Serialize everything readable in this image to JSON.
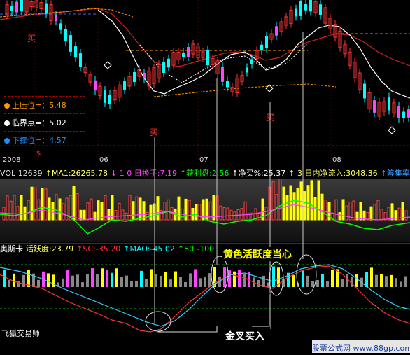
{
  "price_panel": {
    "buy_marks": [
      "买",
      "买",
      "买"
    ],
    "levels": [
      {
        "label": "上压位",
        "value": "=：5.48",
        "color": "#ff9900"
      },
      {
        "label": "临界点",
        "value": "=：5.02",
        "color": "#ffffff"
      },
      {
        "label": "下撑位",
        "value": "=：4.57",
        "color": "#1e90ff"
      }
    ],
    "side_label": "$",
    "months": [
      "2008",
      "06",
      "07",
      "08"
    ]
  },
  "volume_header": {
    "items": [
      {
        "text": "VOL 12639",
        "color": "#dddddd"
      },
      {
        "text": "↑MA1:26265.78",
        "color": "#ffff66"
      },
      {
        "text": "↓ 1 0 日换手:7.19",
        "color": "#ff44ff"
      },
      {
        "text": "↑获利盘:2.56",
        "color": "#00ff00"
      },
      {
        "text": "↑净买%:25.37",
        "color": "#ffffff"
      },
      {
        "text": "↑ 3 日内净流入:3048.36",
        "color": "#ffff66"
      },
      {
        "text": "↑筹集率:",
        "color": "#3399ff"
      }
    ]
  },
  "osc_header": {
    "items": [
      {
        "text": "奥斯卡",
        "color": "#ffffff"
      },
      {
        "text": "活跃度:23.79",
        "color": "#ffff66"
      },
      {
        "text": "↑SC:-35.20",
        "color": "#ff3333"
      },
      {
        "text": "↑MAO:-45.02",
        "color": "#00ffff"
      },
      {
        "text": "↑80",
        "color": "#00ff00"
      },
      {
        "text": "-100",
        "color": "#00ff00"
      }
    ]
  },
  "annotations": {
    "active_text": "黄色活跃度当心",
    "cross_text": "金叉买入",
    "app_name": "飞狐交易师"
  },
  "footer": {
    "brand": "股票公式网 www.88gp.com"
  },
  "colors": {
    "up": "#ff3333",
    "down": "#00ffff",
    "vol_yellow": "#ffff00",
    "osc_magenta": "#ff44ff",
    "grid": "#aa0000"
  }
}
